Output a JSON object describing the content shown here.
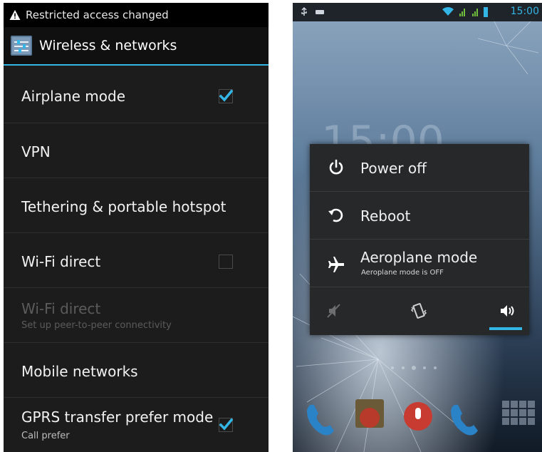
{
  "left_screen": {
    "notification": "Restricted access changed",
    "header_title": "Wireless & networks",
    "items": [
      {
        "title": "Airplane mode",
        "checked": true
      },
      {
        "title": "VPN"
      },
      {
        "title": "Tethering & portable hotspot"
      },
      {
        "title": "Wi-Fi direct",
        "checked": false
      },
      {
        "title": "Wi-Fi direct",
        "subtitle": "Set up peer-to-peer connectivity",
        "enabled": false
      },
      {
        "title": "Mobile networks"
      },
      {
        "title": "GPRS transfer prefer mode",
        "subtitle": "Call prefer",
        "checked": true
      }
    ]
  },
  "right_screen": {
    "status_time": "15:00",
    "menu": [
      {
        "label": "Power off",
        "icon": "power-icon"
      },
      {
        "label": "Reboot",
        "icon": "reboot-icon"
      },
      {
        "label": "Aeroplane mode",
        "sublabel": "Aeroplane mode is OFF",
        "icon": "airplane-icon"
      }
    ],
    "sound_modes": [
      "silent-icon",
      "vibrate-icon",
      "sound-on-icon"
    ],
    "selected_sound_mode": "sound-on-icon"
  },
  "colors": {
    "accent": "#33b5e5",
    "background_dark": "#1c1c1c",
    "dialog": "#262829"
  }
}
